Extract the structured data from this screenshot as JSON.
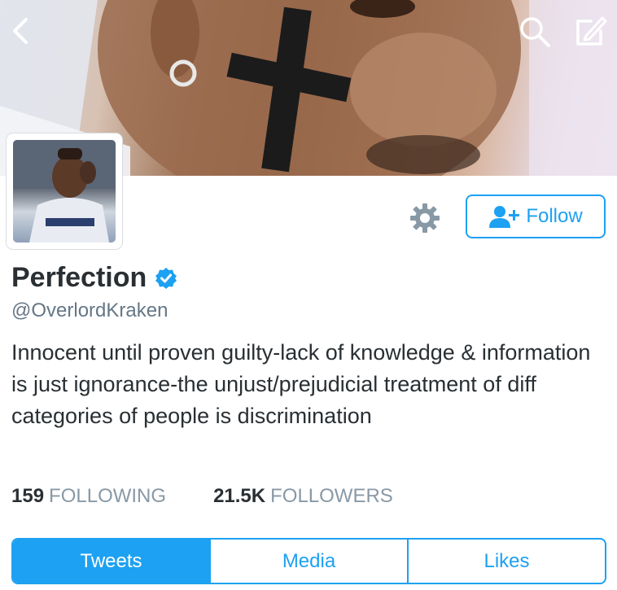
{
  "profile": {
    "name": "Perfection",
    "handle": "@OverlordKraken",
    "bio": "Innocent until proven guilty-lack of knowledge & information is just ignorance-the unjust/prejudicial treatment of diff categories of people is discrimination",
    "verified": true
  },
  "actions": {
    "follow_label": "Follow"
  },
  "stats": {
    "following_count": "159",
    "following_label": "FOLLOWING",
    "followers_count": "21.5K",
    "followers_label": "FOLLOWERS"
  },
  "tabs": [
    {
      "label": "Tweets",
      "active": true
    },
    {
      "label": "Media",
      "active": false
    },
    {
      "label": "Likes",
      "active": false
    }
  ],
  "icons": {
    "back": "back-arrow-icon",
    "search": "search-icon",
    "compose": "compose-icon",
    "settings": "gear-icon",
    "follow": "add-user-icon",
    "verified": "verified-badge-icon"
  },
  "colors": {
    "accent": "#1da1f2",
    "text": "#292f33",
    "secondary": "#657786"
  }
}
